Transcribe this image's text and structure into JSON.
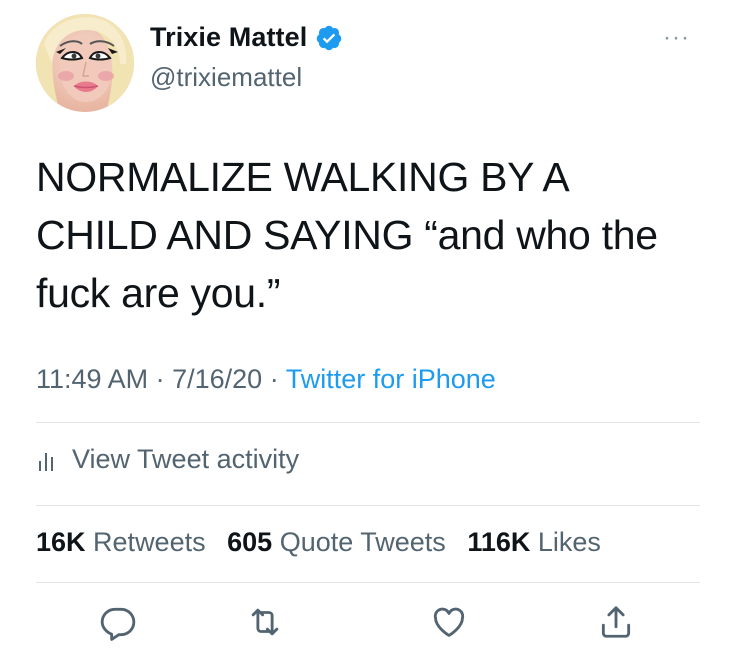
{
  "user": {
    "display_name": "Trixie Mattel",
    "handle": "@trixiemattel",
    "verified": true
  },
  "tweet": {
    "text": "NORMALIZE WALKING BY A CHILD AND SAYING “and who the fuck are you.”",
    "time": "11:49 AM",
    "date": "7/16/20",
    "separator": "·",
    "source": "Twitter for iPhone"
  },
  "activity": {
    "label": "View Tweet activity"
  },
  "stats": {
    "retweets_count": "16K",
    "retweets_label": "Retweets",
    "quotes_count": "605",
    "quotes_label": "Quote Tweets",
    "likes_count": "116K",
    "likes_label": "Likes"
  },
  "more_menu": {
    "glyph": "···"
  },
  "icons": {
    "reply": "reply-icon",
    "retweet": "retweet-icon",
    "like": "heart-icon",
    "share": "share-icon",
    "verified": "verified-badge-icon",
    "activity": "bar-chart-icon"
  },
  "colors": {
    "link": "#1d9bf0",
    "secondary": "#536471",
    "primary_text": "#0f1419",
    "divider": "#dfe3e6"
  }
}
